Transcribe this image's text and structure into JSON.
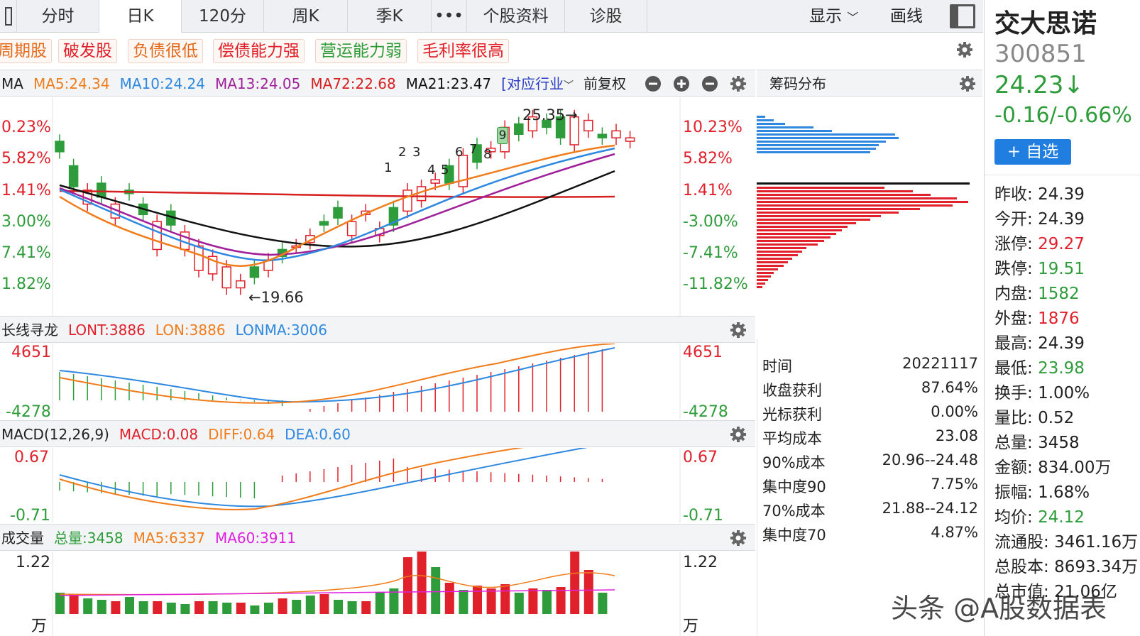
{
  "tabs": [
    "分时",
    "日K",
    "120分",
    "周K",
    "季K",
    "•••",
    "个股资料",
    "诊股"
  ],
  "tabs_right": {
    "display": "显示",
    "draw": "画线"
  },
  "tags": [
    "周期股",
    "破发股",
    "负债很低",
    "偿债能力强",
    "营运能力弱",
    "毛利率很高"
  ],
  "ma_header": {
    "label": "MA",
    "ma5": "MA5:24.34",
    "ma10": "MA10:24.24",
    "ma13": "MA13:24.05",
    "ma72": "MA72:22.68",
    "ma21": "MA21:23.47",
    "industry": "[对应行业",
    "adjust": "前复权"
  },
  "chip_title": "筹码分布",
  "kline": {
    "left_axis": [
      "0.23%",
      "5.82%",
      "1.41%",
      "3.00%",
      "7.41%",
      "1.82%"
    ],
    "right_axis": [
      "10.23%",
      "5.82%",
      "1.41%",
      "-3.00%",
      "-7.41%",
      "-11.82%"
    ],
    "high_label": "25.35→",
    "low_label": "←19.66",
    "seq_labels": [
      "1",
      "2",
      "3",
      "4",
      "5",
      "6",
      "7",
      "8",
      "9"
    ]
  },
  "lon_header": {
    "label": "长线寻龙",
    "lont": "LONT:3886",
    "lon": "LON:3886",
    "lonma": "LONMA:3006"
  },
  "lon_axis": {
    "top": "4651",
    "bottom": "-4278"
  },
  "macd_header": {
    "label": "MACD(12,26,9)",
    "macd": "MACD:0.08",
    "diff": "DIFF:0.64",
    "dea": "DEA:0.60"
  },
  "macd_axis": {
    "top": "0.67",
    "bottom": "-0.71"
  },
  "vol_header": {
    "label": "成交量",
    "total": "总量:3458",
    "ma5": "MA5:6337",
    "ma60": "MA60:3911"
  },
  "vol_axis": {
    "top": "1.22",
    "unit": "万"
  },
  "chip_stats": [
    {
      "k": "时间",
      "v": "20221117"
    },
    {
      "k": "收盘获利",
      "v": "87.64%"
    },
    {
      "k": "光标获利",
      "v": "0.00%"
    },
    {
      "k": "平均成本",
      "v": "23.08"
    },
    {
      "k": "90%成本",
      "v": "20.96--24.48"
    },
    {
      "k": "集中度90",
      "v": "7.75%"
    },
    {
      "k": "70%成本",
      "v": "21.88--24.12"
    },
    {
      "k": "集中度70",
      "v": "4.87%"
    }
  ],
  "stock": {
    "name": "交大思诺",
    "code": "300851",
    "price": "24.23↓",
    "change": "-0.16/-0.66%",
    "add_button": "+ 自选"
  },
  "quote": [
    {
      "k": "昨收:",
      "v": "24.39",
      "c": "#222"
    },
    {
      "k": "今开:",
      "v": "24.39",
      "c": "#222"
    },
    {
      "k": "涨停:",
      "v": "29.27",
      "c": "#e0202a"
    },
    {
      "k": "跌停:",
      "v": "19.51",
      "c": "#2e9c3a"
    },
    {
      "k": "内盘:",
      "v": "1582",
      "c": "#2e9c3a"
    },
    {
      "k": "外盘:",
      "v": "1876",
      "c": "#e0202a"
    },
    {
      "k": "最高:",
      "v": "24.39",
      "c": "#222"
    },
    {
      "k": "最低:",
      "v": "23.98",
      "c": "#2e9c3a"
    },
    {
      "k": "换手:",
      "v": "1.00%",
      "c": "#222"
    },
    {
      "k": "量比:",
      "v": "0.52",
      "c": "#222"
    },
    {
      "k": "总量:",
      "v": "3458",
      "c": "#222"
    },
    {
      "k": "金额:",
      "v": "834.00万",
      "c": "#222"
    },
    {
      "k": "振幅:",
      "v": "1.68%",
      "c": "#222"
    },
    {
      "k": "均价:",
      "v": "24.12",
      "c": "#2e9c3a"
    },
    {
      "k": "流通股:",
      "v": "3461.16万",
      "c": "#222"
    },
    {
      "k": "总股本:",
      "v": "8693.34万",
      "c": "#222"
    },
    {
      "k": "总市值:",
      "v": "21.06亿",
      "c": "#222"
    }
  ],
  "watermark": "头条 @A股数据表",
  "colors": {
    "up": "#e0202a",
    "down": "#2e9c3a",
    "ma5": "#f07c1c",
    "ma10": "#2e88e0",
    "ma13": "#a0209a",
    "ma72": "#d62020",
    "ma21": "#111111"
  }
}
